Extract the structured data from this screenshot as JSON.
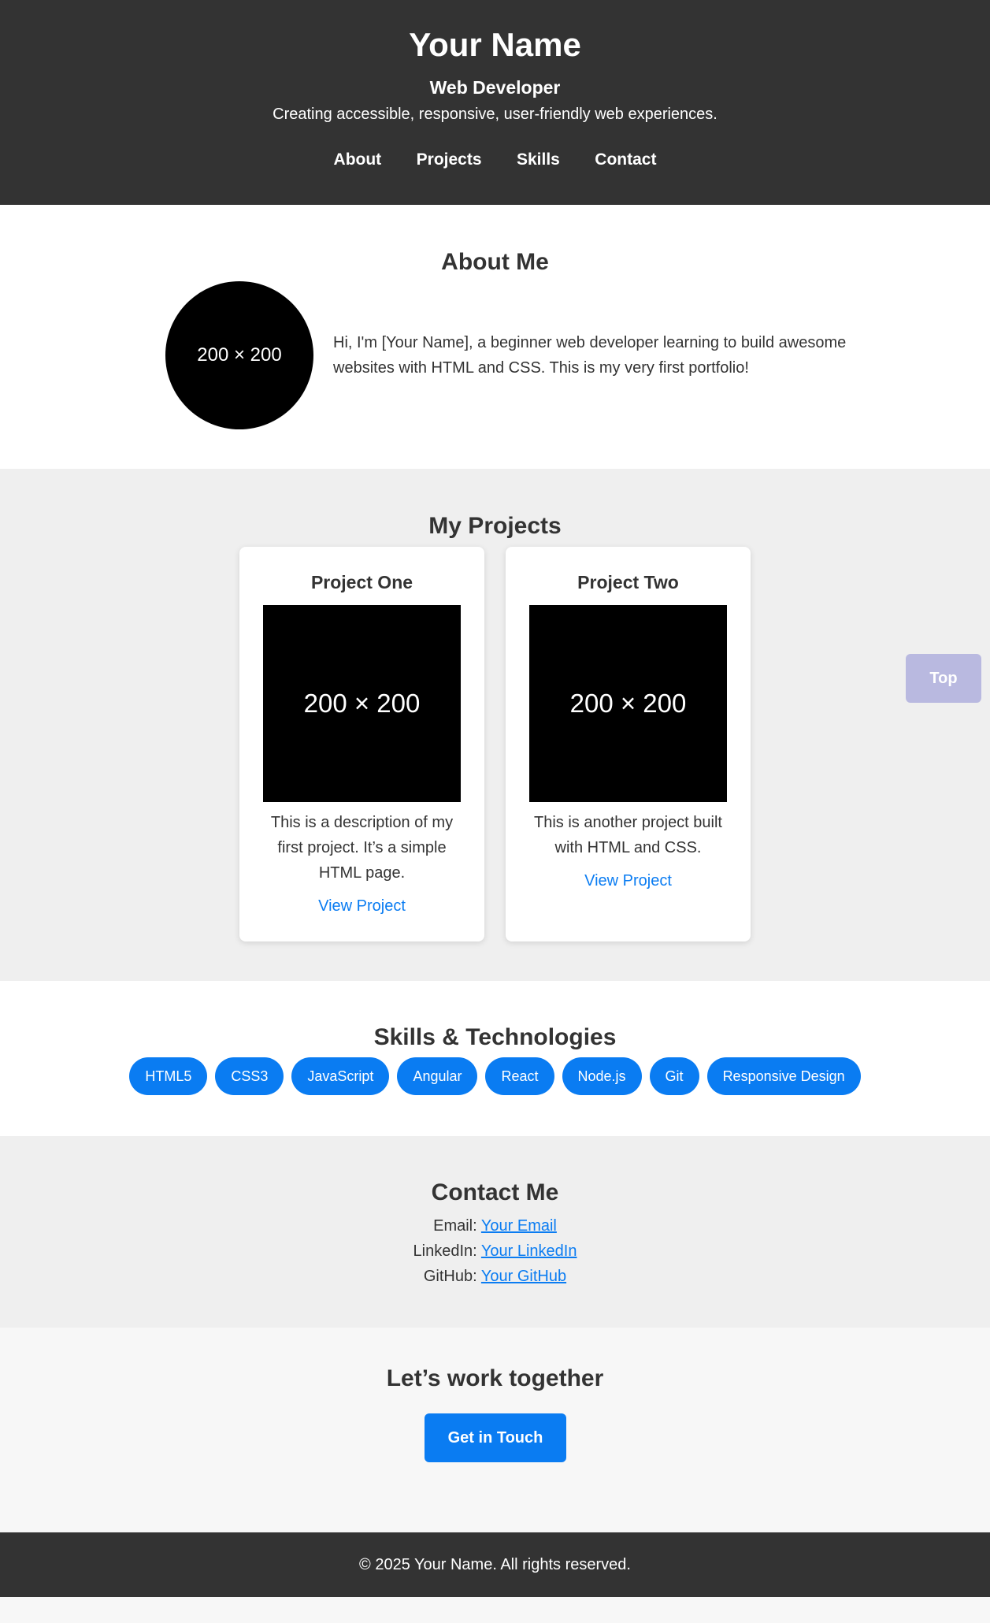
{
  "header": {
    "name": "Your Name",
    "role": "Web Developer",
    "tagline": "Creating accessible, responsive, user-friendly web experiences.",
    "nav": [
      "About",
      "Projects",
      "Skills",
      "Contact"
    ]
  },
  "about": {
    "title": "About Me",
    "avatar_label": "200 × 200",
    "text": "Hi, I'm [Your Name], a beginner web developer learning to build awesome websites with HTML and CSS. This is my very first portfolio!"
  },
  "projects": {
    "title": "My Projects",
    "items": [
      {
        "title": "Project One",
        "thumb_label": "200 × 200",
        "description": "This is a description of my first project. It’s a simple HTML page.",
        "link": "View Project"
      },
      {
        "title": "Project Two",
        "thumb_label": "200 × 200",
        "description": "This is another project built with HTML and CSS.",
        "link": "View Project"
      }
    ]
  },
  "skills": {
    "title": "Skills & Technologies",
    "badges": [
      "HTML5",
      "CSS3",
      "JavaScript",
      "Angular",
      "React",
      "Node.js",
      "Git",
      "Responsive Design"
    ]
  },
  "contact": {
    "title": "Contact Me",
    "lines": [
      {
        "label": "Email:",
        "link": "Your Email"
      },
      {
        "label": "LinkedIn:",
        "link": "Your LinkedIn"
      },
      {
        "label": "GitHub:",
        "link": "Your GitHub"
      }
    ]
  },
  "cta": {
    "title": "Let’s work together",
    "button": "Get in Touch"
  },
  "footer": {
    "text": "© 2025 Your Name. All rights reserved."
  },
  "top_button": "Top",
  "colors": {
    "dark": "#333333",
    "accent": "#0a7cf2",
    "section_gray": "#efefef",
    "top_button": "#b9b9e0"
  }
}
